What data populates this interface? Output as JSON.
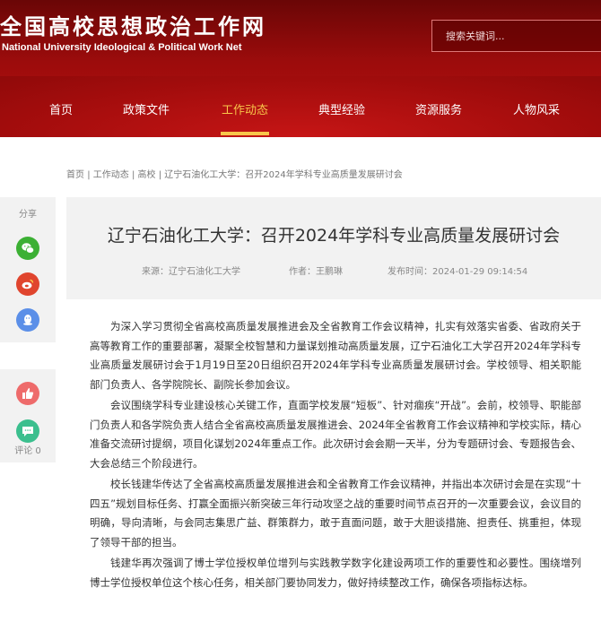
{
  "site": {
    "logo_cn": "全国高校思想政治工作网",
    "logo_en": "National University Ideological & Political Work Net"
  },
  "search": {
    "placeholder": "搜索关键词..."
  },
  "nav": {
    "items": [
      {
        "label": "首页"
      },
      {
        "label": "政策文件"
      },
      {
        "label": "工作动态"
      },
      {
        "label": "典型经验"
      },
      {
        "label": "资源服务"
      },
      {
        "label": "人物风采"
      }
    ],
    "active": "工作动态",
    "active_color": "#f8c64a"
  },
  "breadcrumb": {
    "items": [
      "首页",
      "工作动态",
      "高校",
      "辽宁石油化工大学：召开2024年学科专业高质量发展研讨会"
    ],
    "separator": "|"
  },
  "share": {
    "title": "分享",
    "buttons": [
      {
        "icon": "wechat-icon",
        "color": "#3cb034"
      },
      {
        "icon": "weibo-icon",
        "color": "#e0452e"
      },
      {
        "icon": "qq-icon",
        "color": "#5b8fe8"
      }
    ]
  },
  "reactions": {
    "like_icon": "thumbs-up-icon",
    "like_color": "#ee6b6b",
    "comment_icon": "comment-icon",
    "comment_color": "#3bbf8e",
    "comment_label": "评论 0"
  },
  "article": {
    "title": "辽宁石油化工大学：召开2024年学科专业高质量发展研讨会",
    "source": "来源：辽宁石油化工大学",
    "author": "作者：王鹏琳",
    "date": "发布时间：2024-01-29 09:14:54",
    "paragraphs": [
      "为深入学习贯彻全省高校高质量发展推进会及全省教育工作会议精神，扎实有效落实省委、省政府关于高等教育工作的重要部署，凝聚全校智慧和力量谋划推动高质量发展，辽宁石油化工大学召开2024年学科专业高质量发展研讨会于1月19日至20日组织召开2024年学科专业高质量发展研讨会。学校领导、相关职能部门负责人、各学院院长、副院长参加会议。",
      "会议围绕学科专业建设核心关键工作，直面学校发展“短板”、针对痼疾“开战”。会前，校领导、职能部门负责人和各学院负责人结合全省高校高质量发展推进会、2024年全省教育工作会议精神和学校实际，精心准备交流研讨提纲，项目化谋划2024年重点工作。此次研讨会会期一天半，分为专题研讨会、专题报告会、大会总结三个阶段进行。",
      "校长钱建华传达了全省高校高质量发展推进会和全省教育工作会议精神，并指出本次研讨会是在实现“十四五”规划目标任务、打赢全面振兴新突破三年行动攻坚之战的重要时间节点召开的一次重要会议，会议目的明确，导向清晰，与会同志集思广益、群策群力，敢于直面问题，敢于大胆谈措施、担责任、挑重担，体现了领导干部的担当。",
      "钱建华再次强调了博士学位授权单位增列与实践教学数字化建设两项工作的重要性和必要性。围绕增列博士学位授权单位这个核心任务，相关部门要协同发力，做好持续整改工作，确保各项指标达标。"
    ]
  },
  "colors": {
    "header_red": "#a50d0d",
    "panel_gray": "#f2f2f2"
  }
}
